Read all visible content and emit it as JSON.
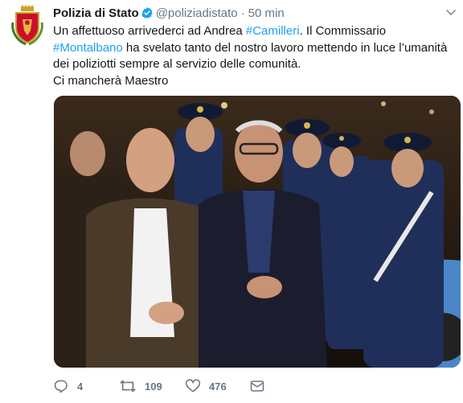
{
  "tweet": {
    "display_name": "Polizia di Stato",
    "handle": "@poliziadistato",
    "separator": "·",
    "time": "50 min",
    "text_parts": {
      "p1": "Un affettuoso arrivederci ad Andrea ",
      "tag1": "#Camilleri",
      "p2": ". Il Commissario ",
      "tag2": "#Montalbano",
      "p3": " ha svelato tanto del nostro lavoro mettendo in luce l’umanità dei poliziotti sempre al servizio delle comunità.",
      "p4": "Ci mancherà Maestro"
    },
    "stats": {
      "replies": "4",
      "retweets": "109",
      "likes": "476"
    }
  },
  "colors": {
    "link": "#1da1f2",
    "secondary_text": "#657786",
    "verified": "#1da1f2",
    "police_red": "#c8102e",
    "police_blue": "#1f2f5a"
  },
  "icons": {
    "avatar": "polizia-emblem-icon",
    "verified": "verified-badge-icon",
    "menu": "chevron-down-icon",
    "reply": "reply-icon",
    "retweet": "retweet-icon",
    "like": "heart-icon",
    "message": "envelope-icon"
  }
}
